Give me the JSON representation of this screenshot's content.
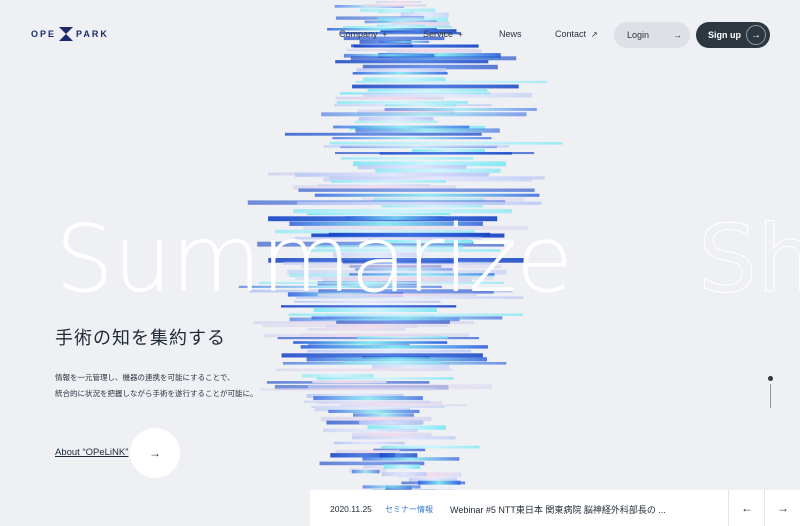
{
  "brand": {
    "left": "OPE",
    "right": "PARK"
  },
  "nav": {
    "items": [
      {
        "label": "Company",
        "arrow": "+"
      },
      {
        "label": "Service",
        "arrow": "+"
      },
      {
        "label": "News",
        "arrow": ""
      },
      {
        "label": "Contact",
        "arrow": "↗"
      }
    ],
    "login": "Login",
    "signup": "Sign up",
    "arrow": "→"
  },
  "hero": {
    "big_word": "Summarize",
    "ghost_word": "Sh",
    "headline": "手術の知を集約する",
    "desc_line1": "情報を一元管理し、機器の連携を可能にすることで、",
    "desc_line2": "統合的に状況を把握しながら手術を遂行することが可能に。",
    "about_link": "About “OPeLiNK”",
    "about_arrow": "→"
  },
  "news": {
    "date": "2020.11.25",
    "category": "セミナー情報",
    "title": "Webinar #5 NTT東日本 関東病院 脳神経外科部長の ...",
    "prev": "←",
    "next": "→"
  },
  "colors": {
    "background": "#eef0f4",
    "navy": "#1c2a6b",
    "dark_button": "#2c3740",
    "accent_blue": "#3a78d4",
    "cyan": "#6fe3f0",
    "deep_blue": "#1846c4"
  }
}
